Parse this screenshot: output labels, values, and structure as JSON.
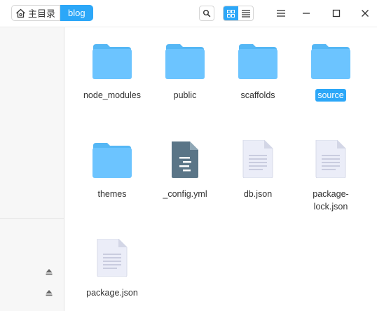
{
  "breadcrumb": {
    "home": "主目录",
    "current": "blog"
  },
  "toolbar": {
    "search_icon": "search-icon",
    "view_modes": [
      "icon-view",
      "list-view"
    ],
    "active_view": "icon-view",
    "window_controls": [
      "menu",
      "minimize",
      "maximize",
      "close"
    ]
  },
  "files": [
    {
      "name": "node_modules",
      "type": "folder",
      "selected": false
    },
    {
      "name": "public",
      "type": "folder",
      "selected": false
    },
    {
      "name": "scaffolds",
      "type": "folder",
      "selected": false
    },
    {
      "name": "source",
      "type": "folder",
      "selected": true
    },
    {
      "name": "themes",
      "type": "folder",
      "selected": false
    },
    {
      "name": "_config.yml",
      "type": "yml",
      "selected": false
    },
    {
      "name": "db.json",
      "type": "json",
      "selected": false
    },
    {
      "name": "package-lock.json",
      "type": "json",
      "selected": false,
      "display_lines": [
        "package-",
        "lock.json"
      ]
    },
    {
      "name": "package.json",
      "type": "json",
      "selected": false
    }
  ],
  "colors": {
    "accent": "#2ca7f8",
    "folder": "#6cc4ff",
    "folder_tab": "#55b7f5",
    "yml": "#5a7587",
    "json_doc": "#ebedf8"
  }
}
